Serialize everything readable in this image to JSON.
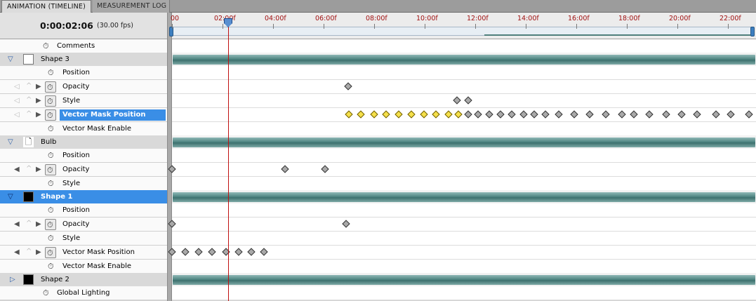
{
  "tabs": {
    "active": "ANIMATION (TIMELINE)",
    "inactive": "MEASUREMENT LOG"
  },
  "header": {
    "current_time": "0:00:02:06",
    "fps": "(30.00 fps)"
  },
  "ruler": {
    "labels": [
      "00",
      "02:00f",
      "04:00f",
      "06:00f",
      "08:00f",
      "10:00f",
      "12:00f",
      "14:00f",
      "16:00f",
      "18:00f",
      "20:00f",
      "22:00f"
    ],
    "playhead_time": "0:00:02:06"
  },
  "tracks": {
    "comments": "Comments",
    "shape3": {
      "name": "Shape 3",
      "position": "Position",
      "opacity": "Opacity",
      "style": "Style",
      "vector_mask_position": "Vector Mask Position",
      "vector_mask_enable": "Vector Mask Enable"
    },
    "bulb": {
      "name": "Bulb",
      "position": "Position",
      "opacity": "Opacity",
      "style": "Style"
    },
    "shape1": {
      "name": "Shape 1",
      "position": "Position",
      "opacity": "Opacity",
      "style": "Style",
      "vector_mask_position": "Vector Mask Position",
      "vector_mask_enable": "Vector Mask Enable"
    },
    "shape2": {
      "name": "Shape 2"
    },
    "global_lighting": "Global Lighting"
  },
  "icons": {
    "twirl_open": "twirl-down-icon",
    "twirl_closed": "twirl-right-icon",
    "stopwatch": "stopwatch-icon",
    "prev_keyframe": "prev-keyframe-icon",
    "add_keyframe": "add-keyframe-icon",
    "next_keyframe": "next-keyframe-icon",
    "layer_doc": "smart-object-icon"
  },
  "colors": {
    "selection": "#3a8ee6",
    "playhead": "#c01010",
    "layer_bar": "#4f8582",
    "keyframe_selected": "#f5e04a",
    "keyframe": "#a9a9a9",
    "ruler_label": "#a01010"
  }
}
